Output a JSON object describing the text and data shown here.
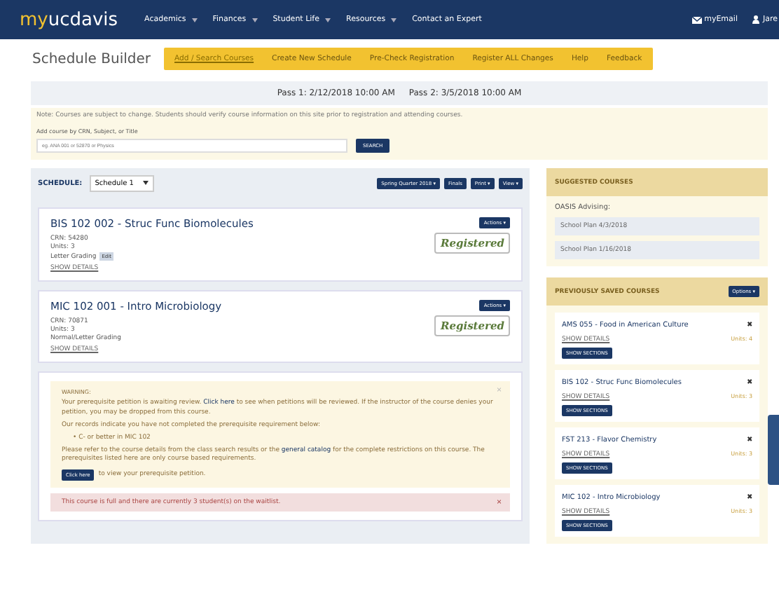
{
  "nav": {
    "logo_a": "my",
    "logo_b": "ucdavis",
    "menu": [
      {
        "label": "Academics",
        "caret": true
      },
      {
        "label": "Finances",
        "caret": true
      },
      {
        "label": "Student Life",
        "caret": true
      },
      {
        "label": "Resources",
        "caret": true
      },
      {
        "label": "Contact an Expert",
        "caret": false
      }
    ],
    "mail": "myEmail",
    "user": "Jare"
  },
  "title": "Schedule Builder",
  "tabs": [
    {
      "label": "Add / Search Courses",
      "selected": true
    },
    {
      "label": "Create New Schedule",
      "selected": false
    },
    {
      "label": "Pre-Check Registration",
      "selected": false
    },
    {
      "label": "Register ALL Changes",
      "selected": false
    },
    {
      "label": "Help",
      "selected": false
    },
    {
      "label": "Feedback",
      "selected": false
    }
  ],
  "passes": [
    "Pass 1: 2/12/2018 10:00 AM",
    "Pass 2: 3/5/2018 10:00 AM"
  ],
  "note": "Note: Courses are subject to change. Students should verify course information on this site prior to registration and attending courses.",
  "search": {
    "label": "Add course by CRN, Subject, or Title",
    "placeholder": "eg. ANA 001 or 52870 or Physics",
    "button": "SEARCH"
  },
  "schedule": {
    "label": "SCHEDULE:",
    "value": "Schedule 1",
    "buttons": [
      "Spring Quarter 2018 ▾",
      "Finals",
      "Print ▾",
      "View ▾"
    ]
  },
  "courses": [
    {
      "title": "BIS 102 002 - Struc Func Biomolecules",
      "crn": "CRN: 54280",
      "units": "Units: 3",
      "grading": "Letter Grading",
      "edit": "Edit",
      "details": "SHOW DETAILS",
      "actions": "Actions ▾",
      "status": "Registered"
    },
    {
      "title": "MIC 102 001 - Intro Microbiology",
      "crn": "CRN: 70871",
      "units": "Units: 3",
      "grading": "Normal/Letter Grading",
      "details": "SHOW DETAILS",
      "actions": "Actions ▾",
      "status": "Registered"
    }
  ],
  "warning": {
    "heading": "WARNING:",
    "paragraphs": [
      [
        {
          "kind": "text",
          "text": "Your prerequisite petition is awaiting review. "
        },
        {
          "kind": "link",
          "text": "Click here"
        },
        {
          "kind": "text",
          "text": " to see when petitions will be reviewed. If the instructor of the course denies your petition, you may be dropped from this course."
        }
      ],
      [
        {
          "kind": "text",
          "text": "Our records indicate you have not completed the prerequisite requirement below:"
        }
      ],
      [
        {
          "kind": "text",
          "text": "Please refer to the course details from the class search results or the "
        },
        {
          "kind": "link",
          "text": "general catalog"
        },
        {
          "kind": "text",
          "text": " for the complete restrictions on this course. The prerequisites listed here are only course based requirements."
        }
      ]
    ],
    "bullets": [
      {
        "marker": "•",
        "text": "C- or better in MIC 102"
      }
    ],
    "button": "Click here",
    "button_text": "to view your prerequisite petition.",
    "close": "×"
  },
  "alert": {
    "text": "This course is full and there are currently 3 student(s) on the waitlist.",
    "close": "×"
  },
  "suggested": {
    "heading": "SUGGESTED COURSES",
    "group": "OASIS Advising:",
    "plans": [
      {
        "label": "School Plan",
        "date": "4/3/2018"
      },
      {
        "label": "School Plan",
        "date": "1/16/2018"
      }
    ]
  },
  "saved": {
    "heading": "PREVIOUSLY SAVED COURSES",
    "options": "Options ▾",
    "items": [
      {
        "title": "AMS 055 - Food in American Culture",
        "details": "SHOW DETAILS",
        "units": "Units: 4",
        "button": "SHOW SECTIONS",
        "remove": "✖"
      },
      {
        "title": "BIS 102 - Struc Func Biomolecules",
        "details": "SHOW DETAILS",
        "units": "Units: 3",
        "button": "SHOW SECTIONS",
        "remove": "✖"
      },
      {
        "title": "FST 213 - Flavor Chemistry",
        "details": "SHOW DETAILS",
        "units": "Units: 3",
        "button": "SHOW SECTIONS",
        "remove": "✖"
      },
      {
        "title": "MIC 102 - Intro Microbiology",
        "details": "SHOW DETAILS",
        "units": "Units: 3",
        "button": "SHOW SECTIONS",
        "remove": "✖"
      }
    ]
  }
}
